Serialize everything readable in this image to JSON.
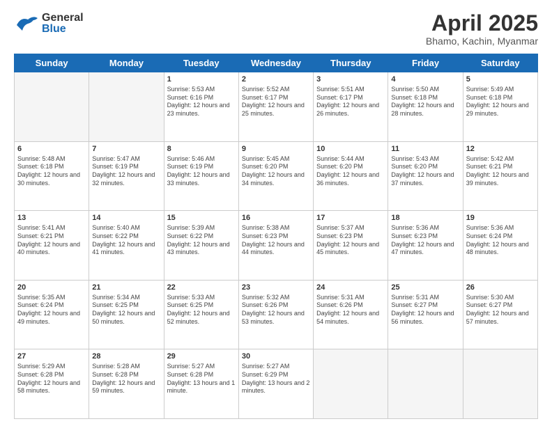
{
  "header": {
    "logo_general": "General",
    "logo_blue": "Blue",
    "month_title": "April 2025",
    "location": "Bhamo, Kachin, Myanmar"
  },
  "days_of_week": [
    "Sunday",
    "Monday",
    "Tuesday",
    "Wednesday",
    "Thursday",
    "Friday",
    "Saturday"
  ],
  "weeks": [
    [
      {
        "day": "",
        "info": ""
      },
      {
        "day": "",
        "info": ""
      },
      {
        "day": "1",
        "info": "Sunrise: 5:53 AM\nSunset: 6:16 PM\nDaylight: 12 hours and 23 minutes."
      },
      {
        "day": "2",
        "info": "Sunrise: 5:52 AM\nSunset: 6:17 PM\nDaylight: 12 hours and 25 minutes."
      },
      {
        "day": "3",
        "info": "Sunrise: 5:51 AM\nSunset: 6:17 PM\nDaylight: 12 hours and 26 minutes."
      },
      {
        "day": "4",
        "info": "Sunrise: 5:50 AM\nSunset: 6:18 PM\nDaylight: 12 hours and 28 minutes."
      },
      {
        "day": "5",
        "info": "Sunrise: 5:49 AM\nSunset: 6:18 PM\nDaylight: 12 hours and 29 minutes."
      }
    ],
    [
      {
        "day": "6",
        "info": "Sunrise: 5:48 AM\nSunset: 6:18 PM\nDaylight: 12 hours and 30 minutes."
      },
      {
        "day": "7",
        "info": "Sunrise: 5:47 AM\nSunset: 6:19 PM\nDaylight: 12 hours and 32 minutes."
      },
      {
        "day": "8",
        "info": "Sunrise: 5:46 AM\nSunset: 6:19 PM\nDaylight: 12 hours and 33 minutes."
      },
      {
        "day": "9",
        "info": "Sunrise: 5:45 AM\nSunset: 6:20 PM\nDaylight: 12 hours and 34 minutes."
      },
      {
        "day": "10",
        "info": "Sunrise: 5:44 AM\nSunset: 6:20 PM\nDaylight: 12 hours and 36 minutes."
      },
      {
        "day": "11",
        "info": "Sunrise: 5:43 AM\nSunset: 6:20 PM\nDaylight: 12 hours and 37 minutes."
      },
      {
        "day": "12",
        "info": "Sunrise: 5:42 AM\nSunset: 6:21 PM\nDaylight: 12 hours and 39 minutes."
      }
    ],
    [
      {
        "day": "13",
        "info": "Sunrise: 5:41 AM\nSunset: 6:21 PM\nDaylight: 12 hours and 40 minutes."
      },
      {
        "day": "14",
        "info": "Sunrise: 5:40 AM\nSunset: 6:22 PM\nDaylight: 12 hours and 41 minutes."
      },
      {
        "day": "15",
        "info": "Sunrise: 5:39 AM\nSunset: 6:22 PM\nDaylight: 12 hours and 43 minutes."
      },
      {
        "day": "16",
        "info": "Sunrise: 5:38 AM\nSunset: 6:23 PM\nDaylight: 12 hours and 44 minutes."
      },
      {
        "day": "17",
        "info": "Sunrise: 5:37 AM\nSunset: 6:23 PM\nDaylight: 12 hours and 45 minutes."
      },
      {
        "day": "18",
        "info": "Sunrise: 5:36 AM\nSunset: 6:23 PM\nDaylight: 12 hours and 47 minutes."
      },
      {
        "day": "19",
        "info": "Sunrise: 5:36 AM\nSunset: 6:24 PM\nDaylight: 12 hours and 48 minutes."
      }
    ],
    [
      {
        "day": "20",
        "info": "Sunrise: 5:35 AM\nSunset: 6:24 PM\nDaylight: 12 hours and 49 minutes."
      },
      {
        "day": "21",
        "info": "Sunrise: 5:34 AM\nSunset: 6:25 PM\nDaylight: 12 hours and 50 minutes."
      },
      {
        "day": "22",
        "info": "Sunrise: 5:33 AM\nSunset: 6:25 PM\nDaylight: 12 hours and 52 minutes."
      },
      {
        "day": "23",
        "info": "Sunrise: 5:32 AM\nSunset: 6:26 PM\nDaylight: 12 hours and 53 minutes."
      },
      {
        "day": "24",
        "info": "Sunrise: 5:31 AM\nSunset: 6:26 PM\nDaylight: 12 hours and 54 minutes."
      },
      {
        "day": "25",
        "info": "Sunrise: 5:31 AM\nSunset: 6:27 PM\nDaylight: 12 hours and 56 minutes."
      },
      {
        "day": "26",
        "info": "Sunrise: 5:30 AM\nSunset: 6:27 PM\nDaylight: 12 hours and 57 minutes."
      }
    ],
    [
      {
        "day": "27",
        "info": "Sunrise: 5:29 AM\nSunset: 6:28 PM\nDaylight: 12 hours and 58 minutes."
      },
      {
        "day": "28",
        "info": "Sunrise: 5:28 AM\nSunset: 6:28 PM\nDaylight: 12 hours and 59 minutes."
      },
      {
        "day": "29",
        "info": "Sunrise: 5:27 AM\nSunset: 6:28 PM\nDaylight: 13 hours and 1 minute."
      },
      {
        "day": "30",
        "info": "Sunrise: 5:27 AM\nSunset: 6:29 PM\nDaylight: 13 hours and 2 minutes."
      },
      {
        "day": "",
        "info": ""
      },
      {
        "day": "",
        "info": ""
      },
      {
        "day": "",
        "info": ""
      }
    ]
  ]
}
